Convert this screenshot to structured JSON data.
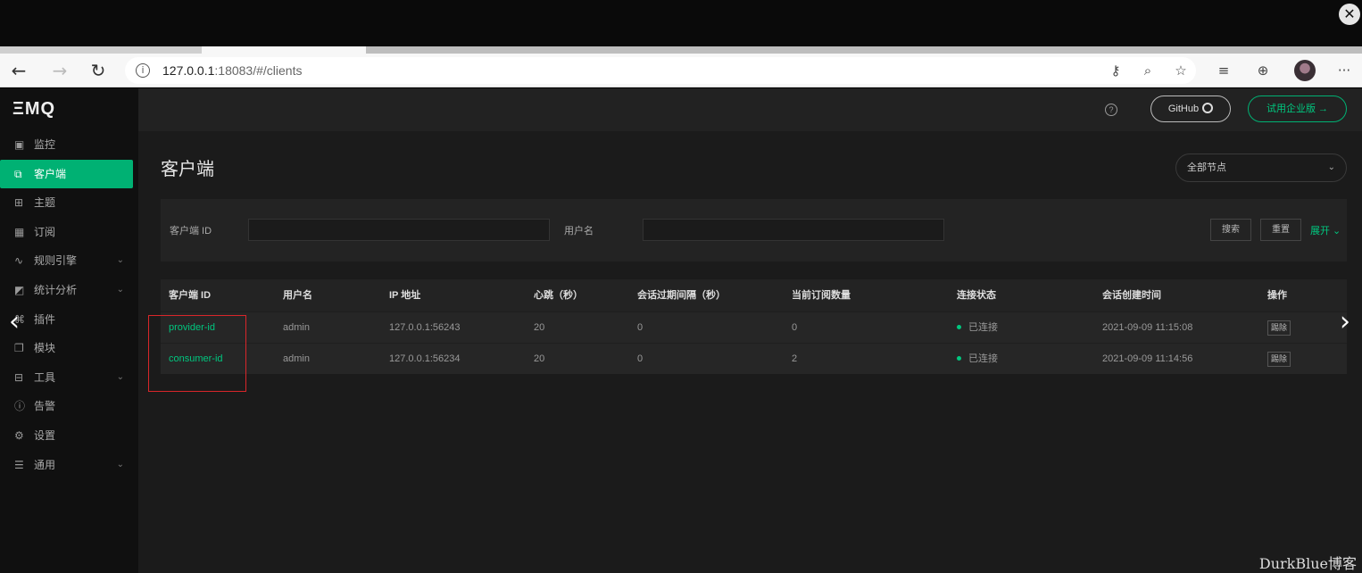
{
  "browser": {
    "close_glyph": "✕",
    "back": "←",
    "forward": "→",
    "reload": "↻",
    "url_host": "127.0.0.1",
    "url_rest": ":18083/#/clients",
    "more": "···"
  },
  "app": {
    "logo": "ΞMQ",
    "header": {
      "github_label": "GitHub",
      "enterprise_label": "试用企业版 →"
    },
    "sidebar": {
      "items": [
        {
          "label": "监控",
          "icon": "monitor-icon"
        },
        {
          "label": "客户端",
          "icon": "clients-icon"
        },
        {
          "label": "主题",
          "icon": "topics-icon"
        },
        {
          "label": "订阅",
          "icon": "subscriptions-icon"
        },
        {
          "label": "规则引擎",
          "icon": "rule-engine-icon"
        },
        {
          "label": "统计分析",
          "icon": "analytics-icon"
        },
        {
          "label": "插件",
          "icon": "plugins-icon"
        },
        {
          "label": "模块",
          "icon": "modules-icon"
        },
        {
          "label": "工具",
          "icon": "tools-icon"
        },
        {
          "label": "告警",
          "icon": "alarm-icon"
        },
        {
          "label": "设置",
          "icon": "settings-icon"
        },
        {
          "label": "通用",
          "icon": "general-icon"
        }
      ]
    },
    "page_title": "客户端",
    "node_select": "全部节点",
    "filter": {
      "client_id_label": "客户端 ID",
      "client_id_value": "",
      "username_label": "用户名",
      "username_value": "",
      "search": "搜索",
      "reset": "重置",
      "expand": "展开 ⌄"
    },
    "table": {
      "headers": [
        "客户端 ID",
        "用户名",
        "IP 地址",
        "心跳（秒）",
        "会话过期间隔（秒）",
        "当前订阅数量",
        "连接状态",
        "会话创建时间",
        "操作"
      ],
      "rows": [
        {
          "client_id": "provider-id",
          "username": "admin",
          "ip": "127.0.0.1:56243",
          "keepalive": "20",
          "expiry": "0",
          "subs": "0",
          "status": "已连接",
          "created": "2021-09-09 11:15:08",
          "action": "踢除"
        },
        {
          "client_id": "consumer-id",
          "username": "admin",
          "ip": "127.0.0.1:56234",
          "keepalive": "20",
          "expiry": "0",
          "subs": "2",
          "status": "已连接",
          "created": "2021-09-09 11:14:56",
          "action": "踢除"
        }
      ]
    }
  },
  "overlay": {
    "prev": "‹",
    "next": "›",
    "watermark": "DurkBlue博客"
  }
}
